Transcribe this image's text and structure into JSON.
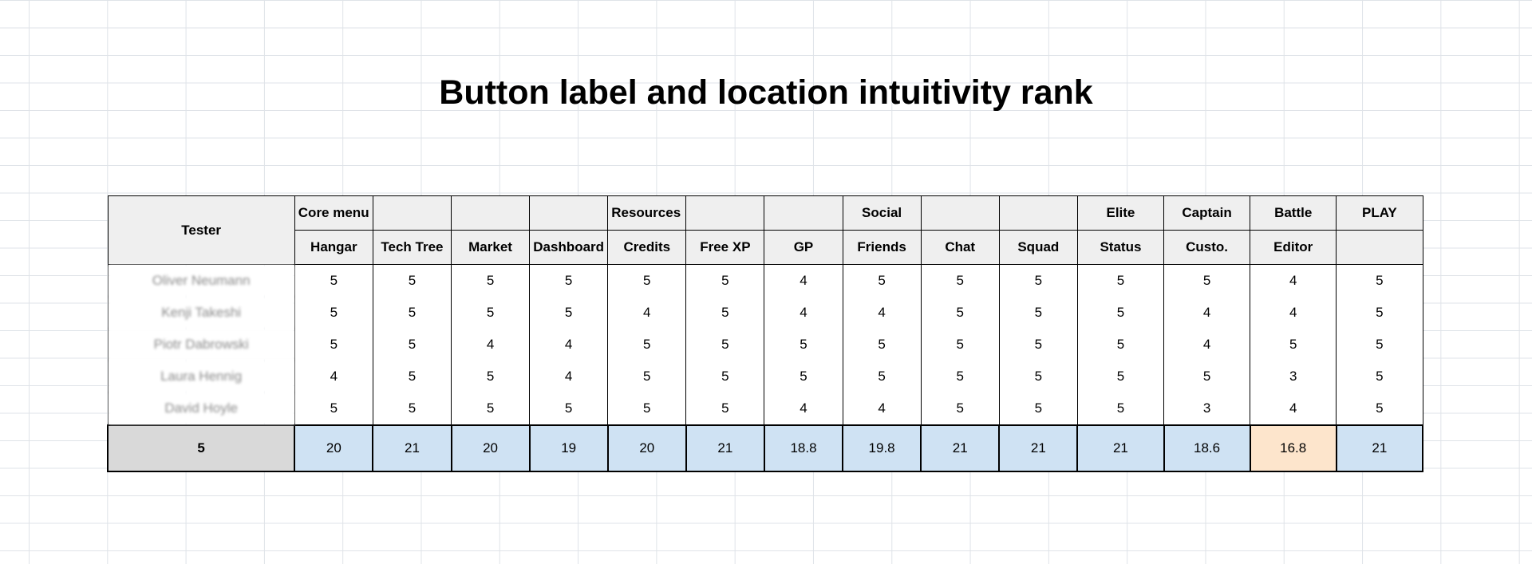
{
  "title": "Button label and location intuitivity rank",
  "table": {
    "tester_header": "Tester",
    "groups": [
      {
        "label": "Core menu",
        "span": 4,
        "align": "left"
      },
      {
        "label": "Resources",
        "span": 3,
        "align": "left"
      },
      {
        "label": "Social",
        "span": 3,
        "align": "center"
      },
      {
        "label": "Elite",
        "span": 1,
        "align": "center"
      },
      {
        "label": "Captain",
        "span": 1,
        "align": "center"
      },
      {
        "label": "Battle",
        "span": 1,
        "align": "center"
      },
      {
        "label": "PLAY",
        "span": 1,
        "align": "center"
      }
    ],
    "columns": [
      "Hangar",
      "Tech Tree",
      "Market",
      "Dashboard",
      "Credits",
      "Free XP",
      "GP",
      "Friends",
      "Chat",
      "Squad",
      "Status",
      "Custo.",
      "Editor",
      ""
    ],
    "rows": [
      {
        "tester": "Oliver Neumann",
        "scores": [
          "5",
          "5",
          "5",
          "5",
          "5",
          "5",
          "4",
          "5",
          "5",
          "5",
          "5",
          "5",
          "4",
          "5"
        ]
      },
      {
        "tester": "Kenji Takeshi",
        "scores": [
          "5",
          "5",
          "5",
          "5",
          "4",
          "5",
          "4",
          "4",
          "5",
          "5",
          "5",
          "4",
          "4",
          "5"
        ]
      },
      {
        "tester": "Piotr Dabrowski",
        "scores": [
          "5",
          "5",
          "4",
          "4",
          "5",
          "5",
          "5",
          "5",
          "5",
          "5",
          "5",
          "4",
          "5",
          "5"
        ]
      },
      {
        "tester": "Laura Hennig",
        "scores": [
          "4",
          "5",
          "5",
          "4",
          "5",
          "5",
          "5",
          "5",
          "5",
          "5",
          "5",
          "5",
          "3",
          "5"
        ]
      },
      {
        "tester": "David Hoyle",
        "scores": [
          "5",
          "5",
          "5",
          "5",
          "5",
          "5",
          "4",
          "4",
          "5",
          "5",
          "5",
          "3",
          "4",
          "5"
        ]
      }
    ],
    "total_count": "5",
    "totals": [
      "20",
      "21",
      "20",
      "19",
      "20",
      "21",
      "18.8",
      "19.8",
      "21",
      "21",
      "21",
      "18.6",
      "16.8",
      "21"
    ],
    "highlight_total_index": 12,
    "colors": {
      "header_bg": "#efefef",
      "total_bg": "#cfe2f3",
      "count_bg": "#d9d9d9",
      "warning_bg": "#fde5cc"
    }
  }
}
